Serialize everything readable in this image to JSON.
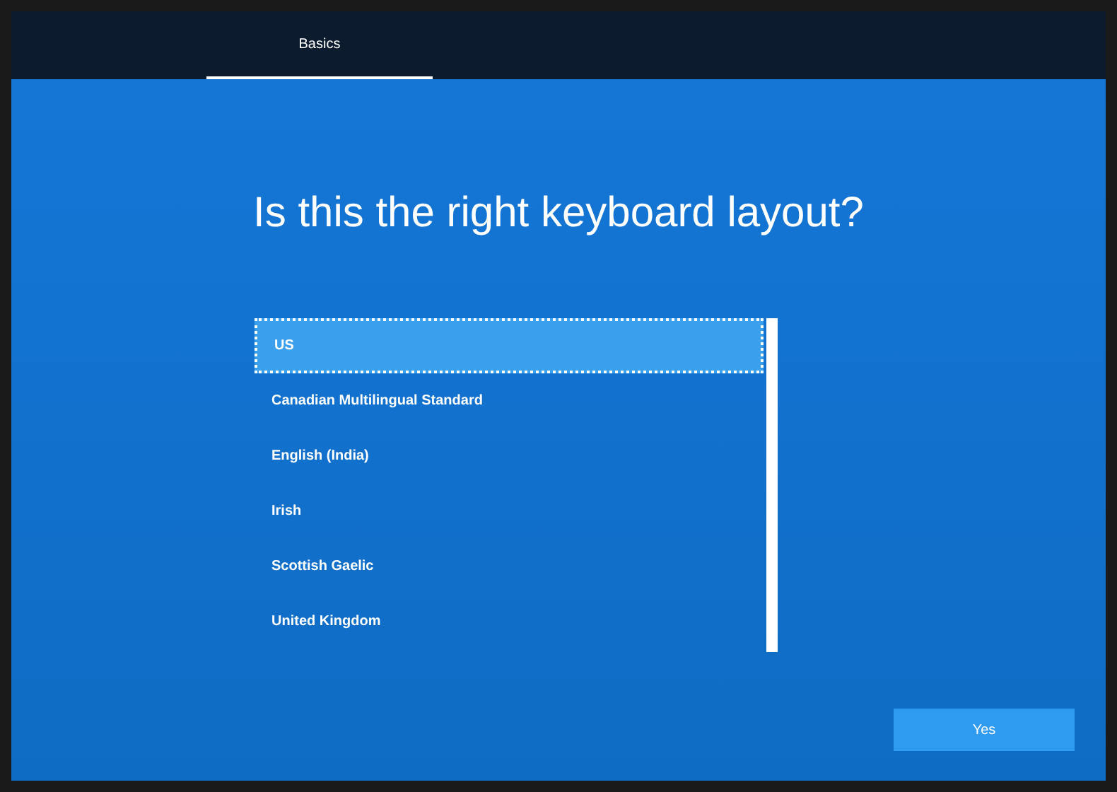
{
  "tabs": [
    {
      "label": "Basics",
      "selected": true
    }
  ],
  "title": "Is this the right keyboard layout?",
  "layouts": [
    {
      "label": "US",
      "selected": true
    },
    {
      "label": "Canadian Multilingual Standard",
      "selected": false
    },
    {
      "label": "English (India)",
      "selected": false
    },
    {
      "label": "Irish",
      "selected": false
    },
    {
      "label": "Scottish Gaelic",
      "selected": false
    },
    {
      "label": "United Kingdom",
      "selected": false
    }
  ],
  "buttons": [
    {
      "label": "Yes"
    }
  ]
}
